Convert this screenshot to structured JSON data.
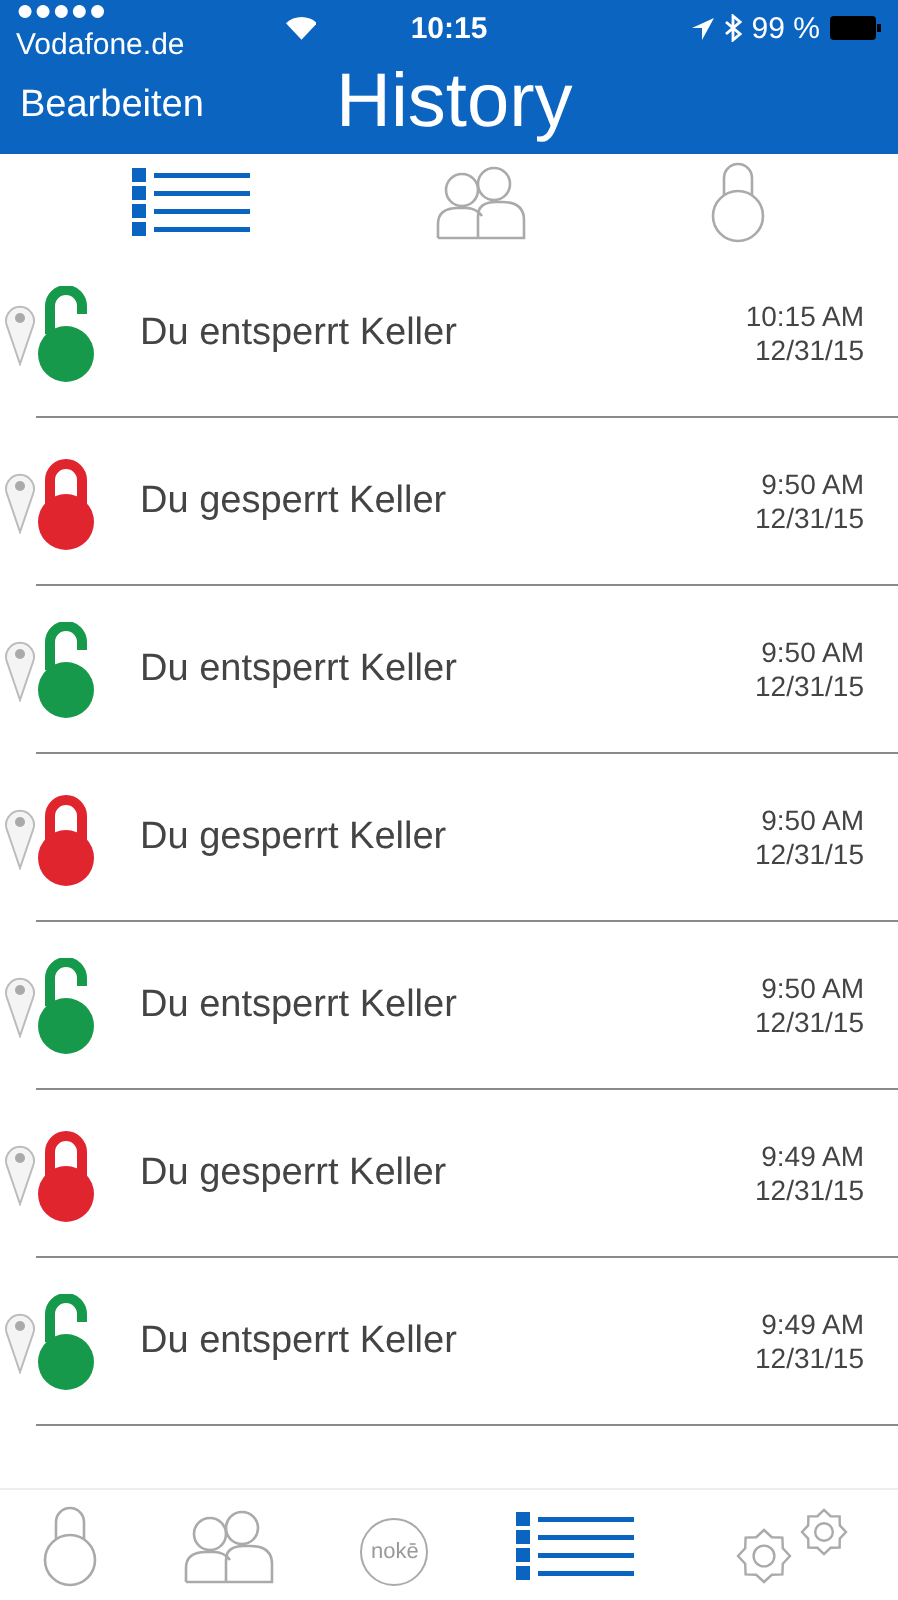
{
  "status_bar": {
    "carrier": "●●●●● Vodafone.de",
    "time": "10:15",
    "battery": "99 %"
  },
  "nav": {
    "left_button": "Bearbeiten",
    "title": "History"
  },
  "top_tabs": [
    {
      "kind": "list",
      "selected": true
    },
    {
      "kind": "people",
      "selected": false
    },
    {
      "kind": "lock",
      "selected": false
    }
  ],
  "events": [
    {
      "kind": "unlocked",
      "text": "Du entsperrt Keller",
      "time": "10:15 AM",
      "date": "12/31/15"
    },
    {
      "kind": "locked",
      "text": "Du gesperrt Keller",
      "time": "9:50 AM",
      "date": "12/31/15"
    },
    {
      "kind": "unlocked",
      "text": "Du entsperrt Keller",
      "time": "9:50 AM",
      "date": "12/31/15"
    },
    {
      "kind": "locked",
      "text": "Du gesperrt Keller",
      "time": "9:50 AM",
      "date": "12/31/15"
    },
    {
      "kind": "unlocked",
      "text": "Du entsperrt Keller",
      "time": "9:50 AM",
      "date": "12/31/15"
    },
    {
      "kind": "locked",
      "text": "Du gesperrt Keller",
      "time": "9:49 AM",
      "date": "12/31/15"
    },
    {
      "kind": "unlocked",
      "text": "Du entsperrt Keller",
      "time": "9:49 AM",
      "date": "12/31/15"
    }
  ],
  "tab_bar": [
    {
      "kind": "lock",
      "selected": false
    },
    {
      "kind": "people",
      "selected": false
    },
    {
      "kind": "noke",
      "label": "nokē",
      "selected": false
    },
    {
      "kind": "list",
      "selected": true
    },
    {
      "kind": "settings",
      "selected": false
    }
  ]
}
